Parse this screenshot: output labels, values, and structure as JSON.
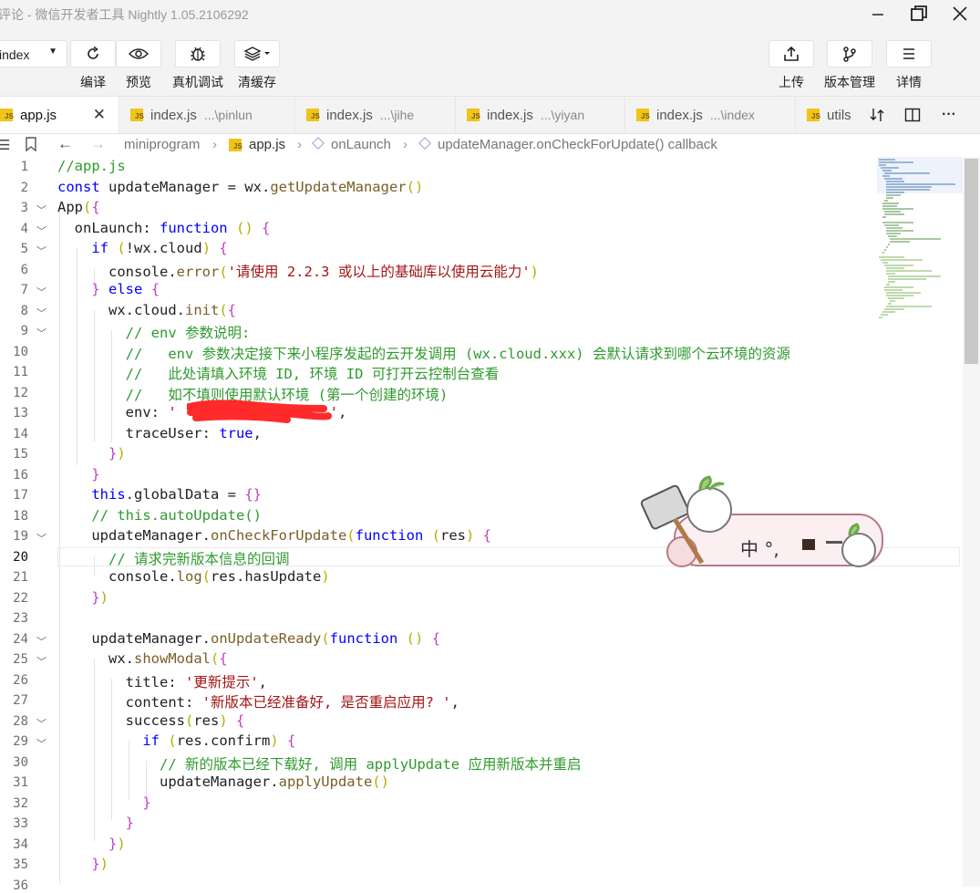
{
  "window": {
    "title": "评论 - 微信开发者工具 Nightly 1.05.2106292",
    "minimize_icon": "minimize-icon",
    "maximize_icon": "maximize-icon",
    "close_icon": "close-icon"
  },
  "toolbar": {
    "page_select_value": "index",
    "compile_label": "编译",
    "preview_label": "预览",
    "remote_debug_label": "真机调试",
    "clear_cache_label": "清缓存",
    "upload_label": "上传",
    "version_label": "版本管理",
    "details_label": "详情"
  },
  "tabs": [
    {
      "name": "app.js",
      "path": "",
      "active": true
    },
    {
      "name": "index.js",
      "path": "...\\pinlun",
      "active": false
    },
    {
      "name": "index.js",
      "path": "...\\jihe",
      "active": false
    },
    {
      "name": "index.js",
      "path": "...\\yiyan",
      "active": false
    },
    {
      "name": "index.js",
      "path": "...\\index",
      "active": false
    },
    {
      "name": "utils",
      "path": "",
      "active": false
    }
  ],
  "breadcrumb": {
    "folder": "miniprogram",
    "file": "app.js",
    "method": "onLaunch",
    "callback": "updateManager.onCheckForUpdate() callback"
  },
  "code": {
    "line_numbers": [
      "1",
      "2",
      "3",
      "4",
      "5",
      "6",
      "7",
      "8",
      "9",
      "10",
      "11",
      "12",
      "13",
      "14",
      "15",
      "16",
      "17",
      "18",
      "19",
      "20",
      "21",
      "22",
      "23",
      "24",
      "25",
      "26",
      "27",
      "28",
      "29",
      "30",
      "31",
      "32",
      "33",
      "34",
      "35",
      "36"
    ],
    "lines": [
      "//app.js",
      "const updateManager = wx.getUpdateManager()",
      "App({",
      "  onLaunch: function () {",
      "    if (!wx.cloud) {",
      "      console.error('请使用 2.2.3 或以上的基础库以使用云能力')",
      "    } else {",
      "      wx.cloud.init({",
      "        // env 参数说明:",
      "        //   env 参数决定接下来小程序发起的云开发调用 (wx.cloud.xxx) 会默认请求到哪个云环境的资源",
      "        //   此处请填入环境 ID, 环境 ID 可打开云控制台查看",
      "        //   如不填则使用默认环境 (第一个创建的环境)",
      "        env: '                  ',",
      "        traceUser: true,",
      "      })",
      "    }",
      "    this.globalData = {}",
      "    // this.autoUpdate()",
      "    updateManager.onCheckForUpdate(function (res) {",
      "      // 请求完新版本信息的回调",
      "      console.log(res.hasUpdate)",
      "    })",
      "",
      "    updateManager.onUpdateReady(function () {",
      "      wx.showModal({",
      "        title: '更新提示',",
      "        content: '新版本已经准备好, 是否重启应用? ',",
      "        success(res) {",
      "          if (res.confirm) {",
      "            // 新的版本已经下载好, 调用 applyUpdate 应用新版本并重启",
      "            updateManager.applyUpdate()",
      "          }",
      "        }",
      "      })",
      "    })",
      ""
    ]
  },
  "sticker": {
    "text": "中  °,"
  }
}
